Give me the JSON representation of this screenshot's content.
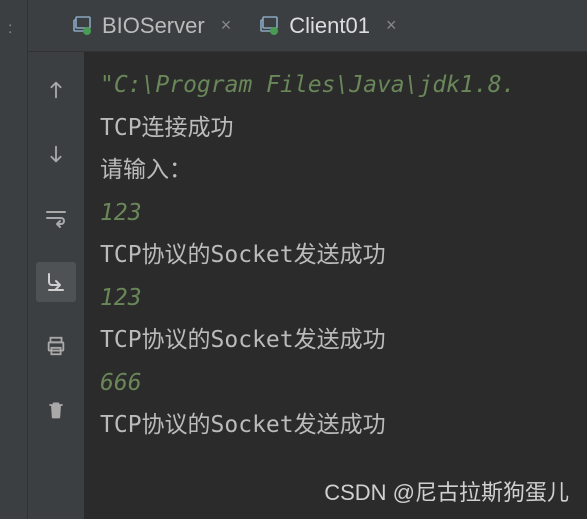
{
  "gutter": {
    "label": ":"
  },
  "tabs": [
    {
      "label": "BIOServer",
      "active": false
    },
    {
      "label": "Client01",
      "active": true
    }
  ],
  "console": {
    "lines": [
      {
        "text": "\"C:\\Program Files\\Java\\jdk1.8.",
        "style": "green"
      },
      {
        "text": "TCP连接成功",
        "style": "normal"
      },
      {
        "text": "请输入：",
        "style": "normal"
      },
      {
        "text": "123",
        "style": "green"
      },
      {
        "text": "TCP协议的Socket发送成功",
        "style": "normal"
      },
      {
        "text": "123",
        "style": "green"
      },
      {
        "text": "TCP协议的Socket发送成功",
        "style": "normal"
      },
      {
        "text": "666",
        "style": "green"
      },
      {
        "text": "TCP协议的Socket发送成功",
        "style": "normal"
      }
    ]
  },
  "watermark": "CSDN @尼古拉斯狗蛋儿"
}
